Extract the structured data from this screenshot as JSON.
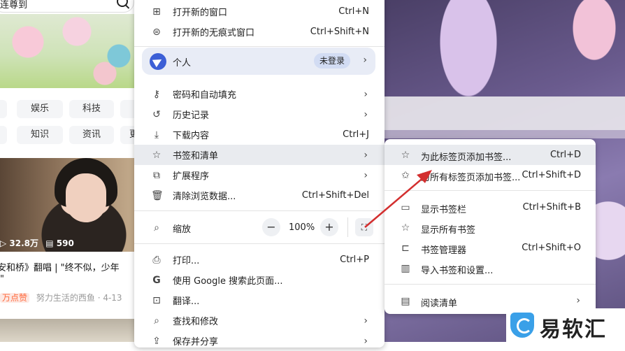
{
  "background_page": {
    "search_text": "连尊到",
    "tags_row1": [
      "娱乐",
      "科技"
    ],
    "tags_row2": [
      "知识",
      "资讯",
      "更"
    ],
    "video": {
      "views": "32.8万",
      "comments": "590",
      "title": "安和桥》翻唱 | \"终不似，少年",
      "title_line2": "\"",
      "badge": "万点赞",
      "author": "努力生活的西鱼",
      "date": "· 4-13"
    }
  },
  "main_menu": {
    "new_window": {
      "label": "打开新的窗口",
      "shortcut": "Ctrl+N",
      "icon": "new-window-icon"
    },
    "new_incognito": {
      "label": "打开新的无痕式窗口",
      "shortcut": "Ctrl+Shift+N",
      "icon": "incognito-icon"
    },
    "profile": {
      "label": "个人",
      "badge": "未登录",
      "icon": "profile-avatar"
    },
    "passwords": {
      "label": "密码和自动填充",
      "icon": "key-icon"
    },
    "history": {
      "label": "历史记录",
      "icon": "history-icon"
    },
    "downloads": {
      "label": "下载内容",
      "shortcut": "Ctrl+J",
      "icon": "download-icon"
    },
    "bookmarks": {
      "label": "书签和清单",
      "icon": "star-icon"
    },
    "extensions": {
      "label": "扩展程序",
      "icon": "puzzle-icon"
    },
    "clear_data": {
      "label": "清除浏览数据...",
      "shortcut": "Ctrl+Shift+Del",
      "icon": "trash-icon"
    },
    "zoom": {
      "label": "缩放",
      "value": "100%",
      "minus": "−",
      "plus": "+",
      "icon": "zoom-icon"
    },
    "print": {
      "label": "打印...",
      "shortcut": "Ctrl+P",
      "icon": "print-icon"
    },
    "google_search": {
      "label": "使用 Google 搜索此页面...",
      "icon": "google-icon"
    },
    "translate": {
      "label": "翻译...",
      "icon": "translate-icon"
    },
    "find": {
      "label": "查找和修改",
      "icon": "find-icon"
    },
    "save_share": {
      "label": "保存并分享",
      "icon": "share-icon"
    }
  },
  "bookmarks_submenu": {
    "add_bookmark": {
      "label": "为此标签页添加书签...",
      "shortcut": "Ctrl+D",
      "icon": "star-outline-icon"
    },
    "add_all": {
      "label": "为所有标签页添加书签...",
      "shortcut": "Ctrl+Shift+D",
      "icon": "star-multiple-icon"
    },
    "show_bar": {
      "label": "显示书签栏",
      "shortcut": "Ctrl+Shift+B",
      "icon": "bookmark-bar-icon"
    },
    "show_all": {
      "label": "显示所有书签",
      "icon": "star-icon"
    },
    "manager": {
      "label": "书签管理器",
      "shortcut": "Ctrl+Shift+O",
      "icon": "folder-star-icon"
    },
    "import": {
      "label": "导入书签和设置...",
      "icon": "book-open-icon"
    },
    "reading_list": {
      "label": "阅读清单",
      "icon": "reading-list-icon"
    }
  },
  "watermark": {
    "text": "易软汇"
  },
  "colors": {
    "highlight": "#e9ebef",
    "arrow": "#d32f2f",
    "profile_bg": "#e8ecf6",
    "avatar": "#3c5fd6"
  }
}
